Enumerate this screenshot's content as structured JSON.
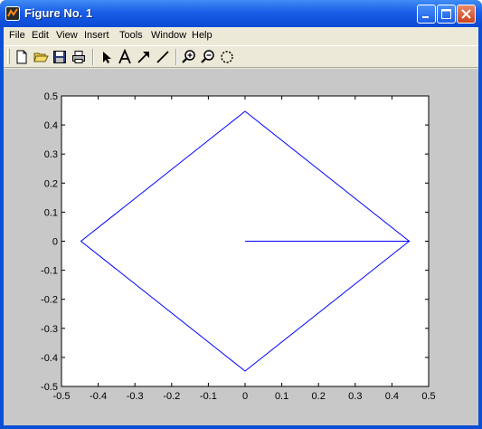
{
  "window": {
    "title": "Figure No. 1",
    "icon": "matlab-figure-icon",
    "controls": [
      "minimize-icon",
      "maximize-icon",
      "close-icon"
    ]
  },
  "menu": {
    "items": [
      "File",
      "Edit",
      "View",
      "Insert",
      "Tools",
      "Window",
      "Help"
    ]
  },
  "toolbar": {
    "buttons": [
      {
        "name": "new-figure-button",
        "icon": "new-document-icon"
      },
      {
        "name": "open-file-button",
        "icon": "open-folder-icon"
      },
      {
        "name": "save-button",
        "icon": "save-disk-icon"
      },
      {
        "name": "print-button",
        "icon": "printer-icon"
      },
      {
        "name": "edit-plot-button",
        "icon": "arrow-cursor-icon"
      },
      {
        "name": "insert-text-button",
        "icon": "text-a-icon"
      },
      {
        "name": "insert-arrow-button",
        "icon": "arrow-line-icon"
      },
      {
        "name": "insert-line-button",
        "icon": "line-icon"
      },
      {
        "name": "zoom-in-button",
        "icon": "zoom-in-icon"
      },
      {
        "name": "zoom-out-button",
        "icon": "zoom-out-icon"
      },
      {
        "name": "rotate-3d-button",
        "icon": "rotate-icon"
      }
    ]
  },
  "colors": {
    "line": "#0000ff",
    "figure_background": "#c8c8c8",
    "axes_background": "#ffffff"
  },
  "chart_data": {
    "type": "line",
    "title": "",
    "xlabel": "",
    "ylabel": "",
    "xlim": [
      -0.5,
      0.5
    ],
    "ylim": [
      -0.5,
      0.5
    ],
    "xticks": [
      -0.5,
      -0.4,
      -0.3,
      -0.2,
      -0.1,
      0,
      0.1,
      0.2,
      0.3,
      0.4,
      0.5
    ],
    "yticks": [
      -0.5,
      -0.4,
      -0.3,
      -0.2,
      -0.1,
      0,
      0.1,
      0.2,
      0.3,
      0.4,
      0.5
    ],
    "xtick_labels": [
      "-0.5",
      "-0.4",
      "-0.3",
      "-0.2",
      "-0.1",
      "0",
      "0.1",
      "0.2",
      "0.3",
      "0.4",
      "0.5"
    ],
    "ytick_labels": [
      "-0.5",
      "-0.4",
      "-0.3",
      "-0.2",
      "-0.1",
      "0",
      "0.1",
      "0.2",
      "0.3",
      "0.4",
      "0.5"
    ],
    "grid": false,
    "series": [
      {
        "x": [
          0,
          0.447,
          0,
          -0.447,
          0,
          0.447
        ],
        "y": [
          0,
          0,
          0.447,
          0,
          -0.447,
          0
        ]
      }
    ]
  }
}
